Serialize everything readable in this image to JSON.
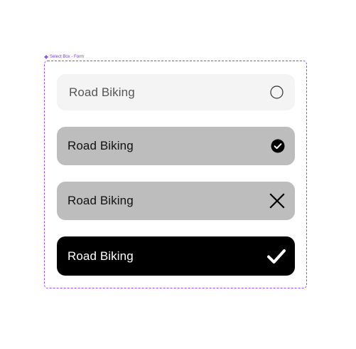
{
  "frame": {
    "title": "Select Box - Form",
    "title_icon": "component-diamond-icon",
    "border_color": "#9747ff"
  },
  "options": [
    {
      "label": "Road Biking",
      "state": "default",
      "icon": "circle-outline-icon",
      "background": "#f4f4f4"
    },
    {
      "label": "Road Biking",
      "state": "selected",
      "icon": "check-circle-filled-icon",
      "background": "#bdbdbd"
    },
    {
      "label": "Road Biking",
      "state": "remove",
      "icon": "close-x-icon",
      "background": "#bdbdbd"
    },
    {
      "label": "Road Biking",
      "state": "active",
      "icon": "checkmark-icon",
      "background": "#000000"
    }
  ]
}
